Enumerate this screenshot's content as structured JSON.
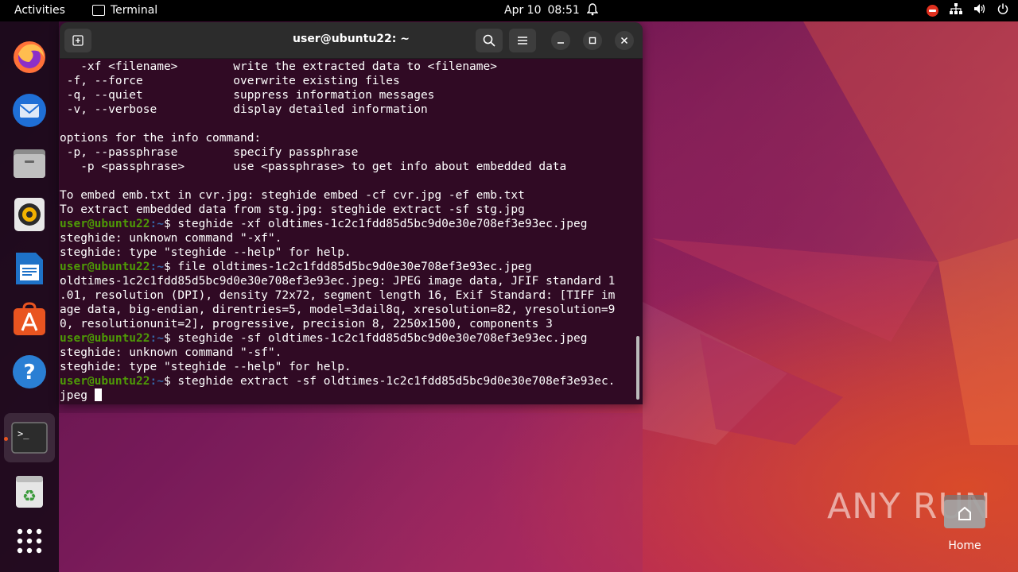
{
  "topbar": {
    "activities": "Activities",
    "app_name": "Terminal",
    "date": "Apr 10",
    "time": "08:51"
  },
  "dock": {
    "items": [
      {
        "name": "firefox-icon"
      },
      {
        "name": "thunderbird-icon"
      },
      {
        "name": "files-icon"
      },
      {
        "name": "rhythmbox-icon"
      },
      {
        "name": "libreoffice-writer-icon"
      },
      {
        "name": "app-center-icon"
      },
      {
        "name": "help-icon"
      },
      {
        "name": "terminal-icon"
      },
      {
        "name": "trash-icon"
      },
      {
        "name": "show-apps-icon"
      }
    ]
  },
  "terminal": {
    "title": "user@ubuntu22: ~",
    "prompt_user": "user@ubuntu22",
    "prompt_path": ":~",
    "lines": [
      {
        "type": "text",
        "text": "   -xf <filename>        write the extracted data to <filename>"
      },
      {
        "type": "text",
        "text": " -f, --force             overwrite existing files"
      },
      {
        "type": "text",
        "text": " -q, --quiet             suppress information messages"
      },
      {
        "type": "text",
        "text": " -v, --verbose           display detailed information"
      },
      {
        "type": "text",
        "text": ""
      },
      {
        "type": "text",
        "text": "options for the info command:"
      },
      {
        "type": "text",
        "text": " -p, --passphrase        specify passphrase"
      },
      {
        "type": "text",
        "text": "   -p <passphrase>       use <passphrase> to get info about embedded data"
      },
      {
        "type": "text",
        "text": ""
      },
      {
        "type": "text",
        "text": "To embed emb.txt in cvr.jpg: steghide embed -cf cvr.jpg -ef emb.txt"
      },
      {
        "type": "text",
        "text": "To extract embedded data from stg.jpg: steghide extract -sf stg.jpg"
      },
      {
        "type": "prompt",
        "text": "$ steghide -xf oldtimes-1c2c1fdd85d5bc9d0e30e708ef3e93ec.jpeg"
      },
      {
        "type": "text",
        "text": "steghide: unknown command \"-xf\"."
      },
      {
        "type": "text",
        "text": "steghide: type \"steghide --help\" for help."
      },
      {
        "type": "prompt",
        "text": "$ file oldtimes-1c2c1fdd85d5bc9d0e30e708ef3e93ec.jpeg"
      },
      {
        "type": "text",
        "text": "oldtimes-1c2c1fdd85d5bc9d0e30e708ef3e93ec.jpeg: JPEG image data, JFIF standard 1"
      },
      {
        "type": "text",
        "text": ".01, resolution (DPI), density 72x72, segment length 16, Exif Standard: [TIFF im"
      },
      {
        "type": "text",
        "text": "age data, big-endian, direntries=5, model=3dail8q, xresolution=82, yresolution=9"
      },
      {
        "type": "text",
        "text": "0, resolutionunit=2], progressive, precision 8, 2250x1500, components 3"
      },
      {
        "type": "prompt",
        "text": "$ steghide -sf oldtimes-1c2c1fdd85d5bc9d0e30e708ef3e93ec.jpeg"
      },
      {
        "type": "text",
        "text": "steghide: unknown command \"-sf\"."
      },
      {
        "type": "text",
        "text": "steghide: type \"steghide --help\" for help."
      },
      {
        "type": "prompt",
        "text": "$ steghide extract -sf oldtimes-1c2c1fdd85d5bc9d0e30e708ef3e93ec."
      },
      {
        "type": "cursor",
        "text": "jpeg "
      }
    ]
  },
  "watermark": "ANY RUN",
  "desktop": {
    "home_label": "Home"
  }
}
